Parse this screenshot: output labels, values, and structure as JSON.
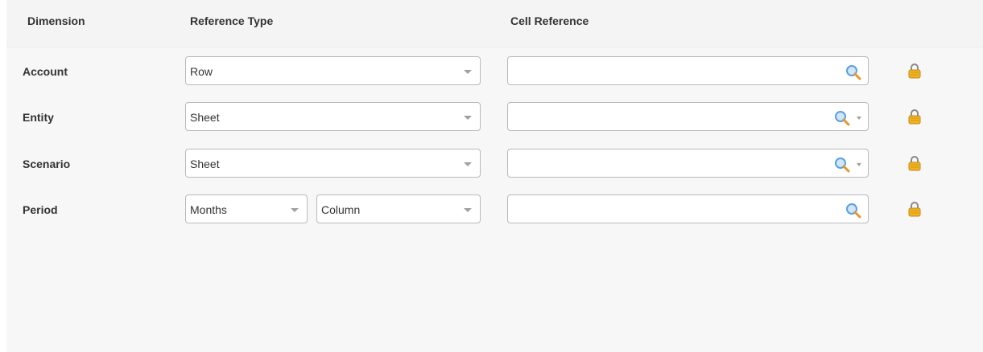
{
  "header": {
    "dimension": "Dimension",
    "reference_type": "Reference Type",
    "cell_reference": "Cell Reference"
  },
  "rows": [
    {
      "label": "Account",
      "type": "Row"
    },
    {
      "label": "Entity",
      "type": "Sheet"
    },
    {
      "label": "Scenario",
      "type": "Sheet"
    },
    {
      "label": "Period",
      "type_primary": "Months",
      "type_secondary": "Column"
    }
  ],
  "icons": {
    "search": "magnifier-icon",
    "lock": "lock-icon",
    "dropdown": "chevron-down-icon"
  },
  "colors": {
    "panel_bg": "#f7f7f7",
    "field_border": "#b9b9b9",
    "lock_gold": "#f0b323",
    "magnifier_blue": "#5aa0e0",
    "magnifier_handle": "#e8962b"
  }
}
